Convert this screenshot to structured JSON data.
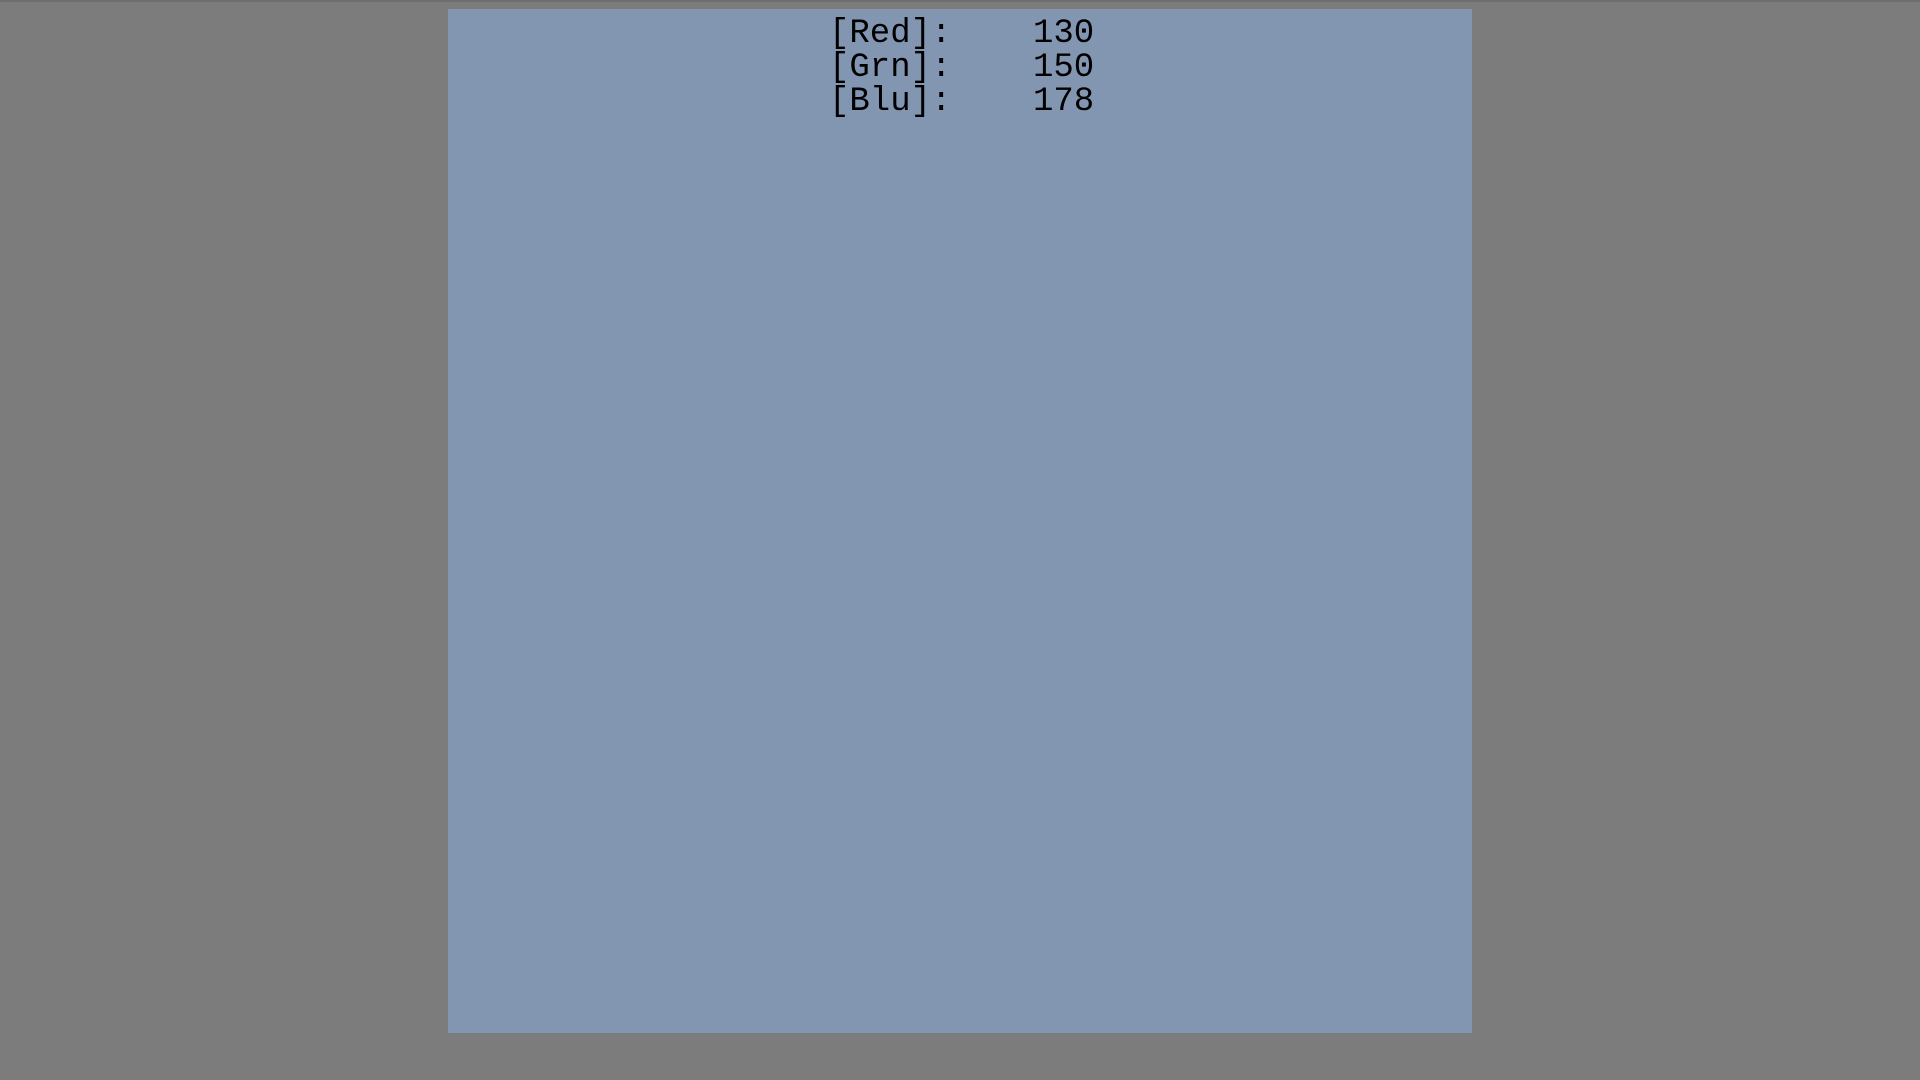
{
  "colors": {
    "background": "#7c7c7c",
    "swatch": "#8296b2",
    "text": "#000000"
  },
  "readout": {
    "rows": [
      {
        "label": "[Red]",
        "sep": ":",
        "value": "130"
      },
      {
        "label": "[Grn]",
        "sep": ":",
        "value": "150"
      },
      {
        "label": "[Blu]",
        "sep": ":",
        "value": "178"
      }
    ]
  }
}
